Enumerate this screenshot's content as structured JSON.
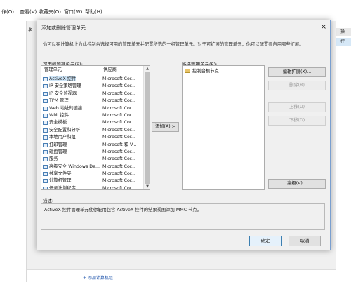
{
  "app": {
    "menu": [
      "作(O)",
      "查看(V)",
      "收藏夹(O)",
      "窗口(W)",
      "帮助(H)"
    ],
    "name_header": "名",
    "right_header": "操",
    "right_band": "控",
    "status_link": "+ 添加计算机组"
  },
  "dialog": {
    "title": "添加或删除管理单元",
    "close": "×",
    "intro": "你可以在计算机上为此控制台选择可用的管理单元并配置所选的一组管理单元。对于可扩展的管理单元，你可以配置要启用哪些扩展。",
    "available_label": "可用的管理单元(S):",
    "selected_label": "所选管理单元(E):",
    "columns": {
      "name": "管理单元",
      "vendor": "供应商"
    },
    "snapins": [
      {
        "name": "ActiveX 控件",
        "vendor": "Microsoft Cor..."
      },
      {
        "name": "IP 安全策略管理",
        "vendor": "Microsoft Cor..."
      },
      {
        "name": "IP 安全监视器",
        "vendor": "Microsoft Cor..."
      },
      {
        "name": "TPM 管理",
        "vendor": "Microsoft Cor..."
      },
      {
        "name": "Web 地址的链接",
        "vendor": "Microsoft Cor..."
      },
      {
        "name": "WMI 控件",
        "vendor": "Microsoft Cor..."
      },
      {
        "name": "安全模板",
        "vendor": "Microsoft Cor..."
      },
      {
        "name": "安全配置和分析",
        "vendor": "Microsoft Cor..."
      },
      {
        "name": "本地用户和组",
        "vendor": "Microsoft Cor..."
      },
      {
        "name": "打印管理",
        "vendor": "Microsoft 和 V..."
      },
      {
        "name": "磁盘管理",
        "vendor": "Microsoft Cor..."
      },
      {
        "name": "服务",
        "vendor": "Microsoft Cor..."
      },
      {
        "name": "高级安全 Windows De...",
        "vendor": "Microsoft Cor..."
      },
      {
        "name": "共享文件夹",
        "vendor": "Microsoft Cor..."
      },
      {
        "name": "计算机管理",
        "vendor": "Microsoft Cor..."
      },
      {
        "name": "任务计划程序",
        "vendor": "Microsoft Cor..."
      }
    ],
    "add_button": "添加(A) >",
    "selected_items": [
      "控制台根节点"
    ],
    "edit_ext_button": "编辑扩展(X)...",
    "remove_button": "删除(R)",
    "move_up_button": "上移(U)",
    "move_down_button": "下移(D)",
    "advanced_button": "高级(V)...",
    "desc_label": "描述:",
    "description": "ActiveX 控件管理单元使你能用包含 ActiveX 控件的结果视图添加 MMC 节点。",
    "ok_button": "确定",
    "cancel_button": "取消"
  }
}
